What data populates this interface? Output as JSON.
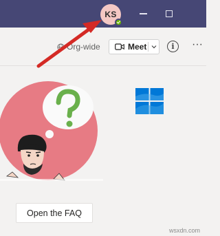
{
  "titlebar": {
    "avatar_initials": "KS",
    "presence_status": "available",
    "minimize_icon": "minimize-icon",
    "maximize_icon": "maximize-icon",
    "bg_color": "#464775"
  },
  "toolbar": {
    "org_label": "Org-wide",
    "meet_label": "Meet",
    "info_glyph": "i",
    "more_glyph": "···"
  },
  "main": {
    "faq_button_label": "Open the FAQ",
    "illustration_icon": "confused-person-illustration",
    "logo_icon": "windows-logo-icon"
  },
  "annotation": {
    "arrow_color": "#d42a25"
  },
  "watermark": "wsxdn.com"
}
